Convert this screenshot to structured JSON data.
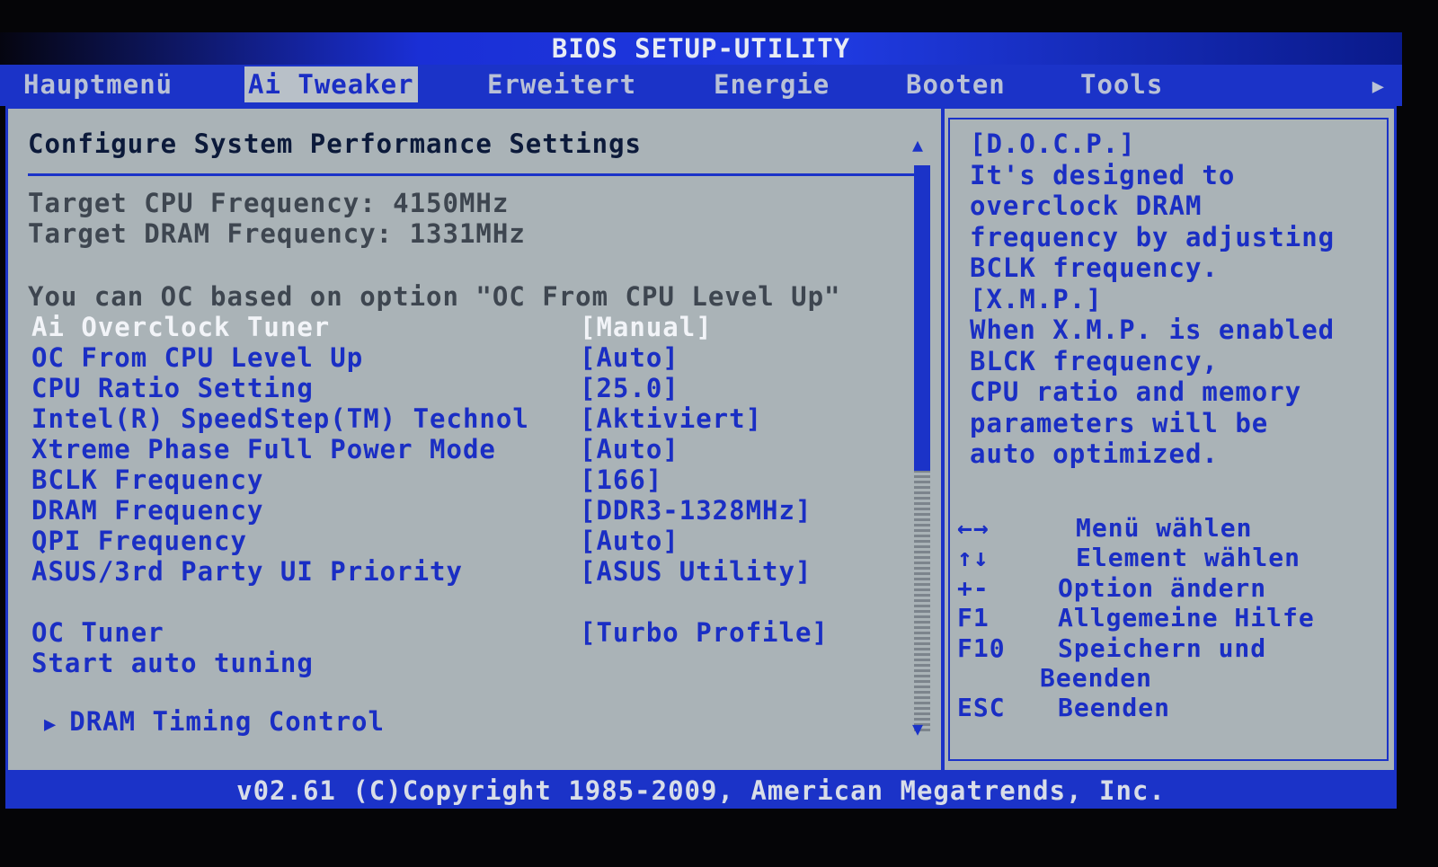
{
  "title": "BIOS SETUP-UTILITY",
  "menu": {
    "tabs": [
      {
        "label": "Hauptmenü"
      },
      {
        "label": "Ai Tweaker"
      },
      {
        "label": "Erweitert"
      },
      {
        "label": "Energie"
      },
      {
        "label": "Booten"
      },
      {
        "label": "Tools"
      }
    ],
    "active": "Ai Tweaker"
  },
  "main": {
    "heading": "Configure System Performance Settings",
    "info": [
      "Target CPU Frequency: 4150MHz",
      "Target DRAM Frequency: 1331MHz",
      "You can OC based on option \"OC From CPU Level Up\""
    ],
    "settings": [
      {
        "label": "Ai Overclock Tuner",
        "value": "[Manual]"
      },
      {
        "label": "OC From CPU Level Up",
        "value": "[Auto]"
      },
      {
        "label": "CPU Ratio Setting",
        "value": "[25.0]"
      },
      {
        "label": "Intel(R) SpeedStep(TM) Technol",
        "value": "[Aktiviert]"
      },
      {
        "label": "Xtreme Phase Full Power Mode",
        "value": "[Auto]"
      },
      {
        "label": "BCLK Frequency",
        "value": "[166]"
      },
      {
        "label": "DRAM Frequency",
        "value": "[DDR3-1328MHz]"
      },
      {
        "label": "QPI Frequency",
        "value": "[Auto]"
      },
      {
        "label": "ASUS/3rd Party UI Priority",
        "value": "[ASUS Utility]"
      },
      {
        "label": "OC Tuner",
        "value": "[Turbo Profile]"
      },
      {
        "label": "Start auto tuning",
        "value": ""
      }
    ],
    "submenu": "DRAM Timing Control"
  },
  "help": {
    "lines": [
      "[D.O.C.P.]",
      "It's designed to",
      "overclock DRAM",
      "frequency by adjusting",
      "BCLK frequency.",
      "[X.M.P.]",
      "When X.M.P. is enabled",
      "BLCK frequency,",
      "CPU ratio and memory",
      "parameters will be",
      "auto optimized."
    ],
    "keys": [
      {
        "key": "←→",
        "desc": "Menü wählen"
      },
      {
        "key": "↑↓",
        "desc": "Element wählen"
      },
      {
        "key": "+-",
        "desc": "Option ändern"
      },
      {
        "key": "F1",
        "desc": "Allgemeine Hilfe"
      },
      {
        "key": "F10",
        "desc": "Speichern und"
      },
      {
        "key": "",
        "desc": "Beenden"
      },
      {
        "key": "ESC",
        "desc": "Beenden"
      }
    ]
  },
  "footer": "v02.61 (C)Copyright 1985-2009, American Megatrends, Inc."
}
